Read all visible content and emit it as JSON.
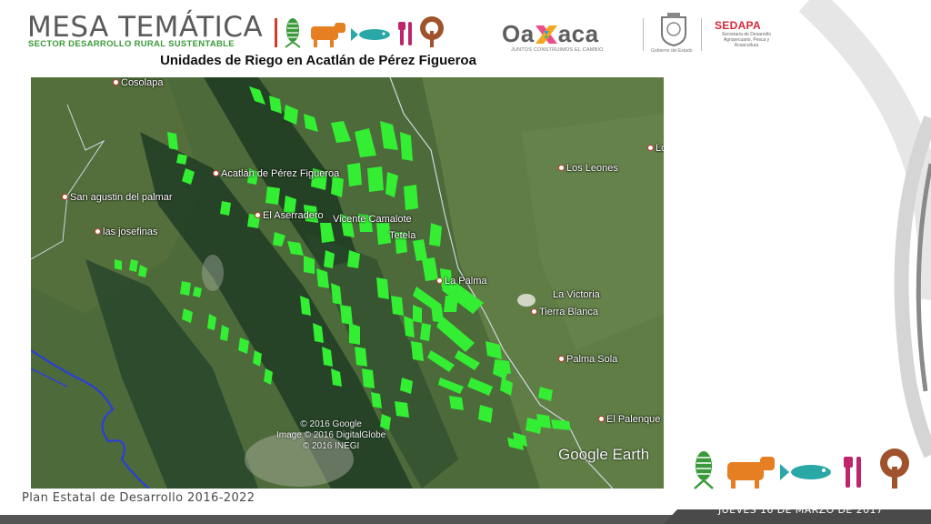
{
  "header": {
    "title": "MESA TEMÁTICA",
    "subtitle": "SECTOR DESARROLLO RURAL SUSTENTABLE",
    "sector_icons": [
      "corn-icon",
      "cow-icon",
      "fish-icon",
      "utensils-icon",
      "tree-icon"
    ]
  },
  "logos": {
    "oaxaca_left": "Oa",
    "oaxaca_right": "aca",
    "oaxaca_tagline": "JUNTOS CONSTRUIMOS EL CAMBIO",
    "gobierno_caption": "Gobierno del Estado",
    "sedapa_name": "SEDAPA",
    "sedapa_description": "Secretaría de Desarrollo Agropecuario, Pesca y Acuacultura"
  },
  "map": {
    "title": "Unidades de Riego en Acatlán de Pérez Figueroa",
    "places": [
      {
        "name": "Cosolapa"
      },
      {
        "name": "Acatlán de Pérez Figueroa"
      },
      {
        "name": "San agustin del palmar"
      },
      {
        "name": "las josefinas"
      },
      {
        "name": "El Aserradero"
      },
      {
        "name": "Vicente Camalote"
      },
      {
        "name": "Tetela"
      },
      {
        "name": "La Palma"
      },
      {
        "name": "Los Leones"
      },
      {
        "name": "Lo"
      },
      {
        "name": "La Victoria"
      },
      {
        "name": "Tierra Blanca"
      },
      {
        "name": "Palma Sola"
      },
      {
        "name": "El Palenque"
      }
    ],
    "credits": [
      "© 2016 Google",
      "Image © 2016 DigitalGlobe",
      "© 2016 INEGI"
    ],
    "provider": "Google Earth",
    "colors": {
      "irrigation_units": "#33ee33",
      "border_line": "#cfd8e0",
      "river": "#2a40d8"
    }
  },
  "footer": {
    "plan": "Plan Estatal de Desarrollo 2016-2022",
    "date": "JUEVES 16 DE MARZO DE 2017"
  }
}
